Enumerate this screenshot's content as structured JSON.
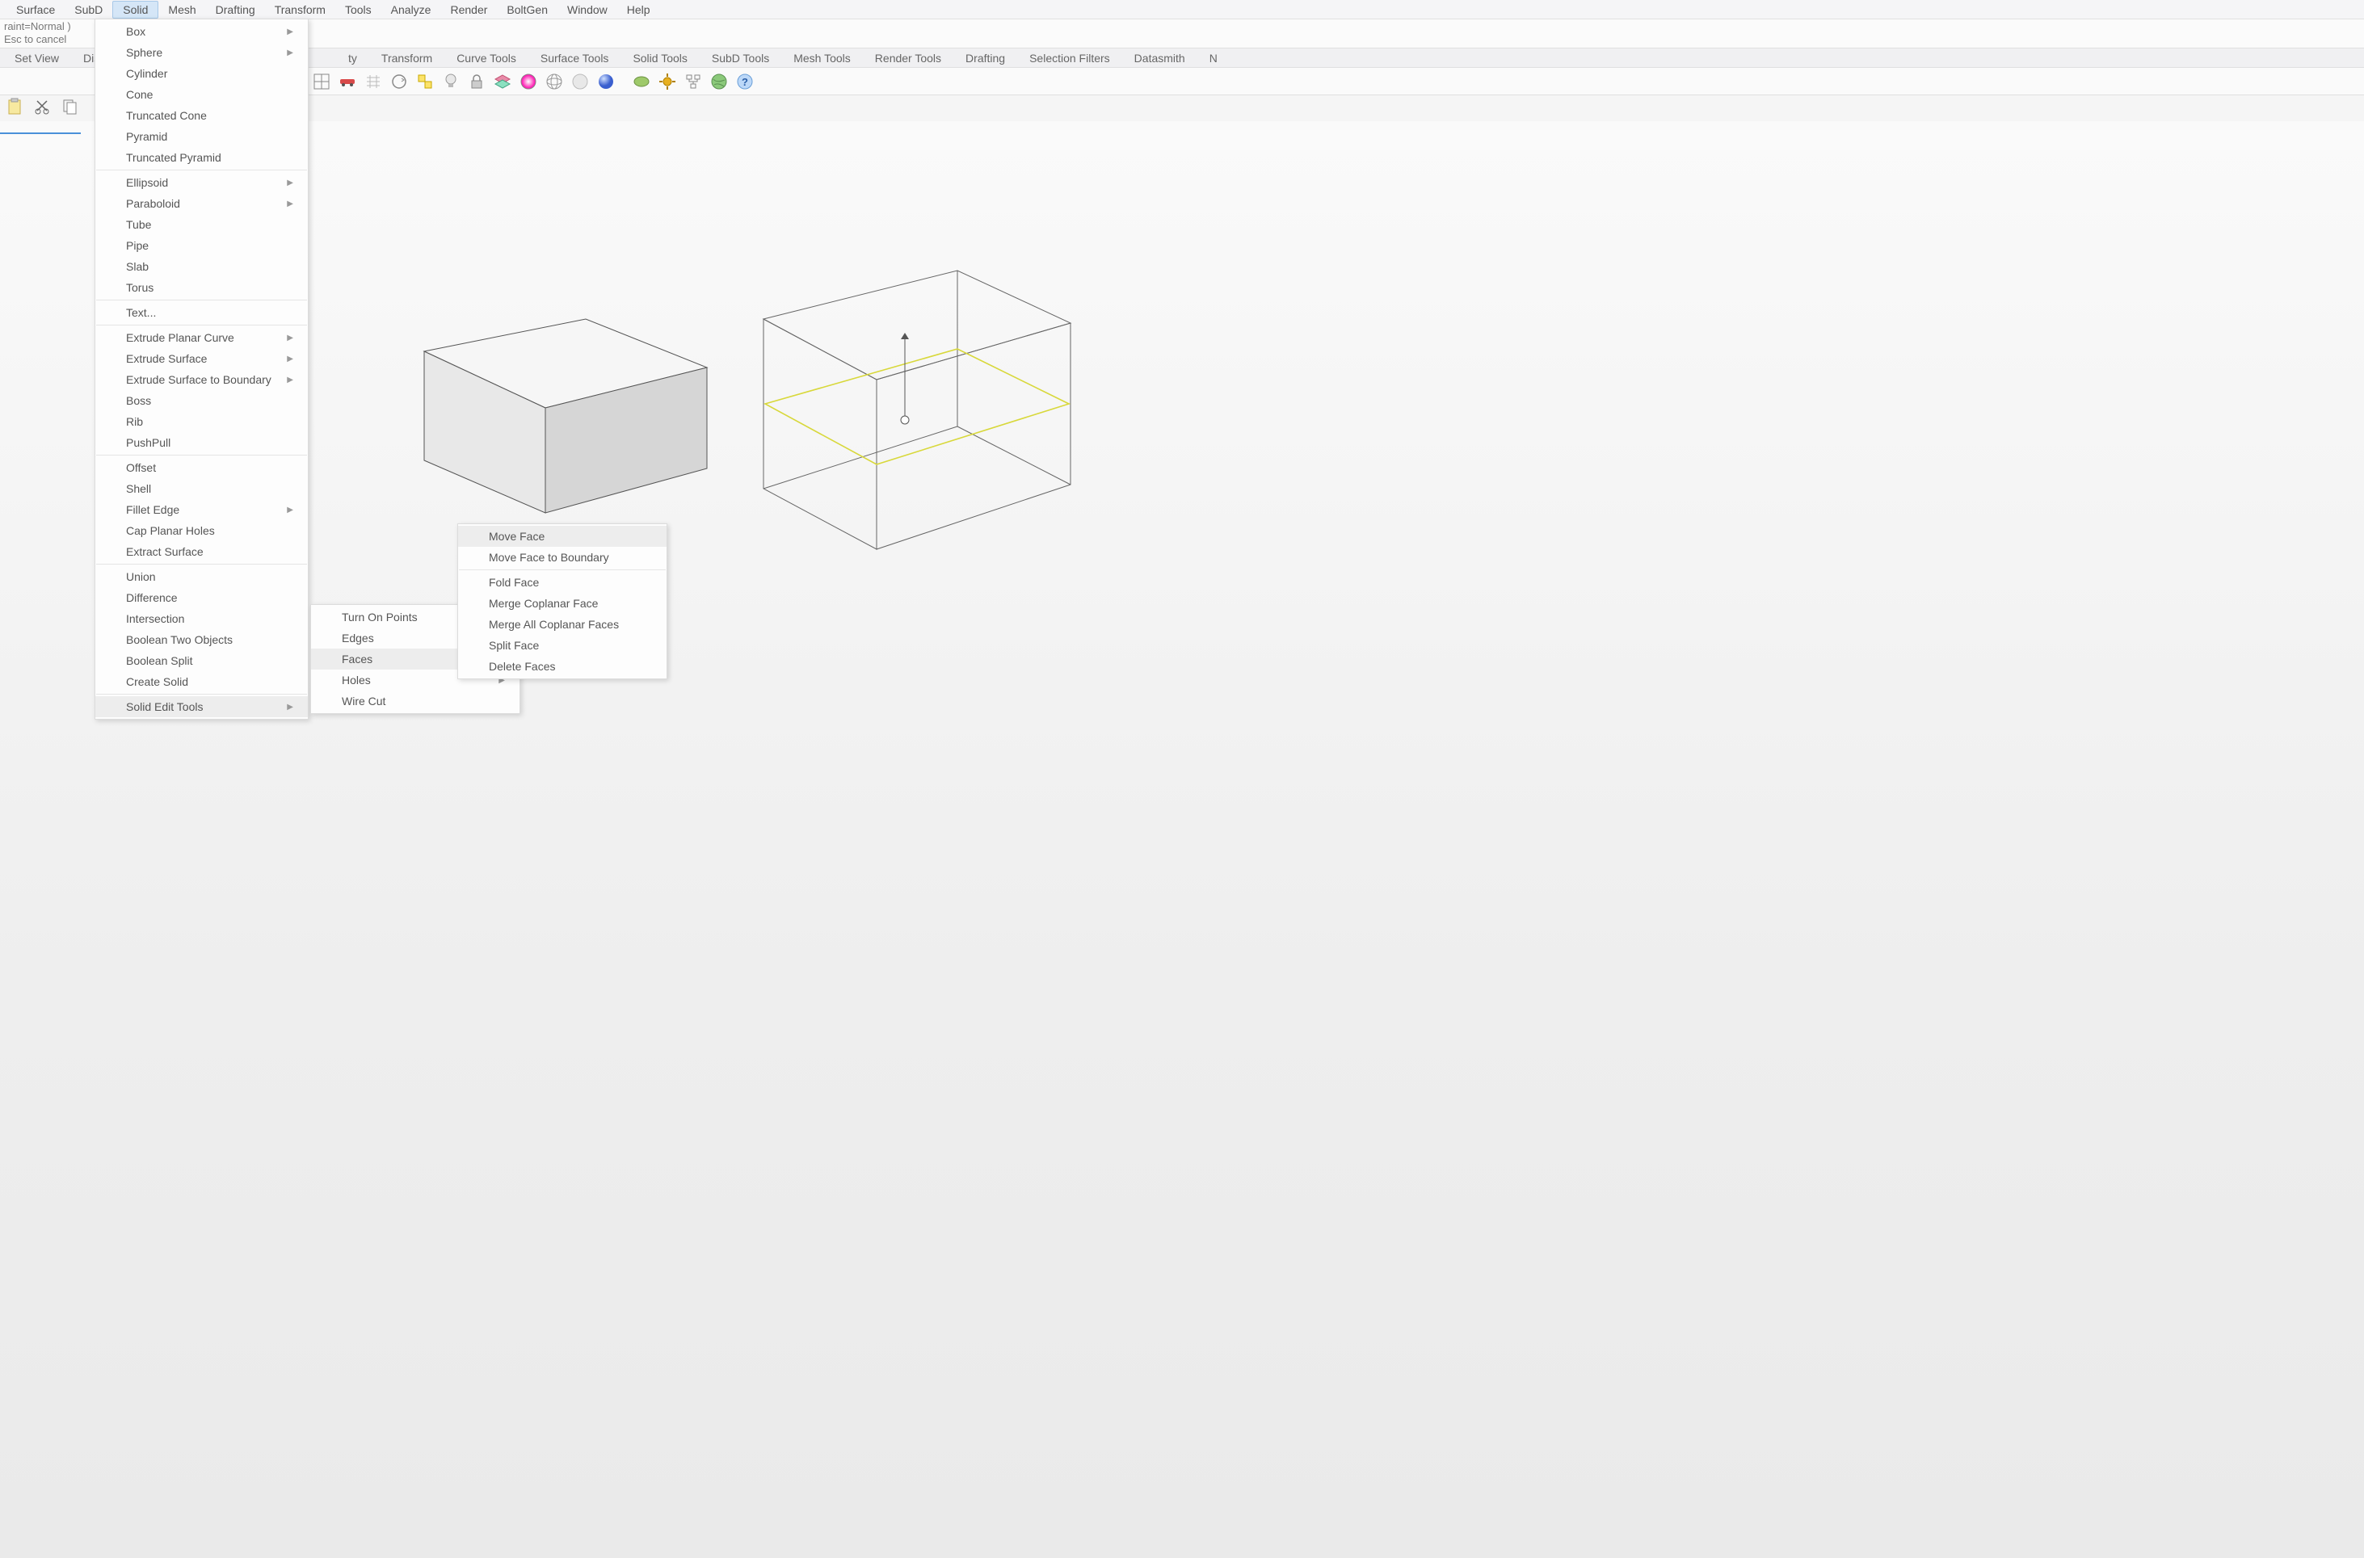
{
  "menubar": [
    "Surface",
    "SubD",
    "Solid",
    "Mesh",
    "Drafting",
    "Transform",
    "Tools",
    "Analyze",
    "Render",
    "BoltGen",
    "Window",
    "Help"
  ],
  "menubar_active": "Solid",
  "command_lines": [
    "raint=Normal )",
    "Esc to cancel"
  ],
  "toolbar_tabs": [
    "Set View",
    "Disp",
    "ty",
    "Transform",
    "Curve Tools",
    "Surface Tools",
    "Solid Tools",
    "SubD Tools",
    "Mesh Tools",
    "Render Tools",
    "Drafting",
    "Selection Filters",
    "Datasmith",
    "N"
  ],
  "solid_menu": {
    "groups": [
      [
        {
          "label": "Box",
          "arrow": true
        },
        {
          "label": "Sphere",
          "arrow": true
        },
        {
          "label": "Cylinder"
        },
        {
          "label": "Cone"
        },
        {
          "label": "Truncated Cone"
        },
        {
          "label": "Pyramid"
        },
        {
          "label": "Truncated Pyramid"
        }
      ],
      [
        {
          "label": "Ellipsoid",
          "arrow": true
        },
        {
          "label": "Paraboloid",
          "arrow": true
        },
        {
          "label": "Tube"
        },
        {
          "label": "Pipe"
        },
        {
          "label": "Slab"
        },
        {
          "label": "Torus"
        }
      ],
      [
        {
          "label": "Text..."
        }
      ],
      [
        {
          "label": "Extrude Planar Curve",
          "arrow": true
        },
        {
          "label": "Extrude Surface",
          "arrow": true
        },
        {
          "label": "Extrude Surface to Boundary",
          "arrow": true
        },
        {
          "label": "Boss"
        },
        {
          "label": "Rib"
        },
        {
          "label": "PushPull"
        }
      ],
      [
        {
          "label": "Offset"
        },
        {
          "label": "Shell"
        },
        {
          "label": "Fillet Edge",
          "arrow": true
        },
        {
          "label": "Cap Planar Holes"
        },
        {
          "label": "Extract Surface"
        }
      ],
      [
        {
          "label": "Union"
        },
        {
          "label": "Difference"
        },
        {
          "label": "Intersection"
        },
        {
          "label": "Boolean Two Objects"
        },
        {
          "label": "Boolean Split"
        },
        {
          "label": "Create Solid"
        }
      ],
      [
        {
          "label": "Solid Edit Tools",
          "arrow": true,
          "hover": true
        }
      ]
    ]
  },
  "submenu_edit": [
    {
      "label": "Turn On Points"
    },
    {
      "label": "Edges",
      "arrow": true
    },
    {
      "label": "Faces",
      "arrow": true,
      "hover": true
    },
    {
      "label": "Holes",
      "arrow": true
    },
    {
      "label": "Wire Cut"
    }
  ],
  "submenu_faces": {
    "groups": [
      [
        {
          "label": "Move Face",
          "hover": true
        },
        {
          "label": "Move Face to Boundary"
        }
      ],
      [
        {
          "label": "Fold Face"
        },
        {
          "label": "Merge Coplanar Face"
        },
        {
          "label": "Merge All Coplanar Faces"
        },
        {
          "label": "Split Face"
        },
        {
          "label": "Delete Faces"
        }
      ]
    ]
  }
}
